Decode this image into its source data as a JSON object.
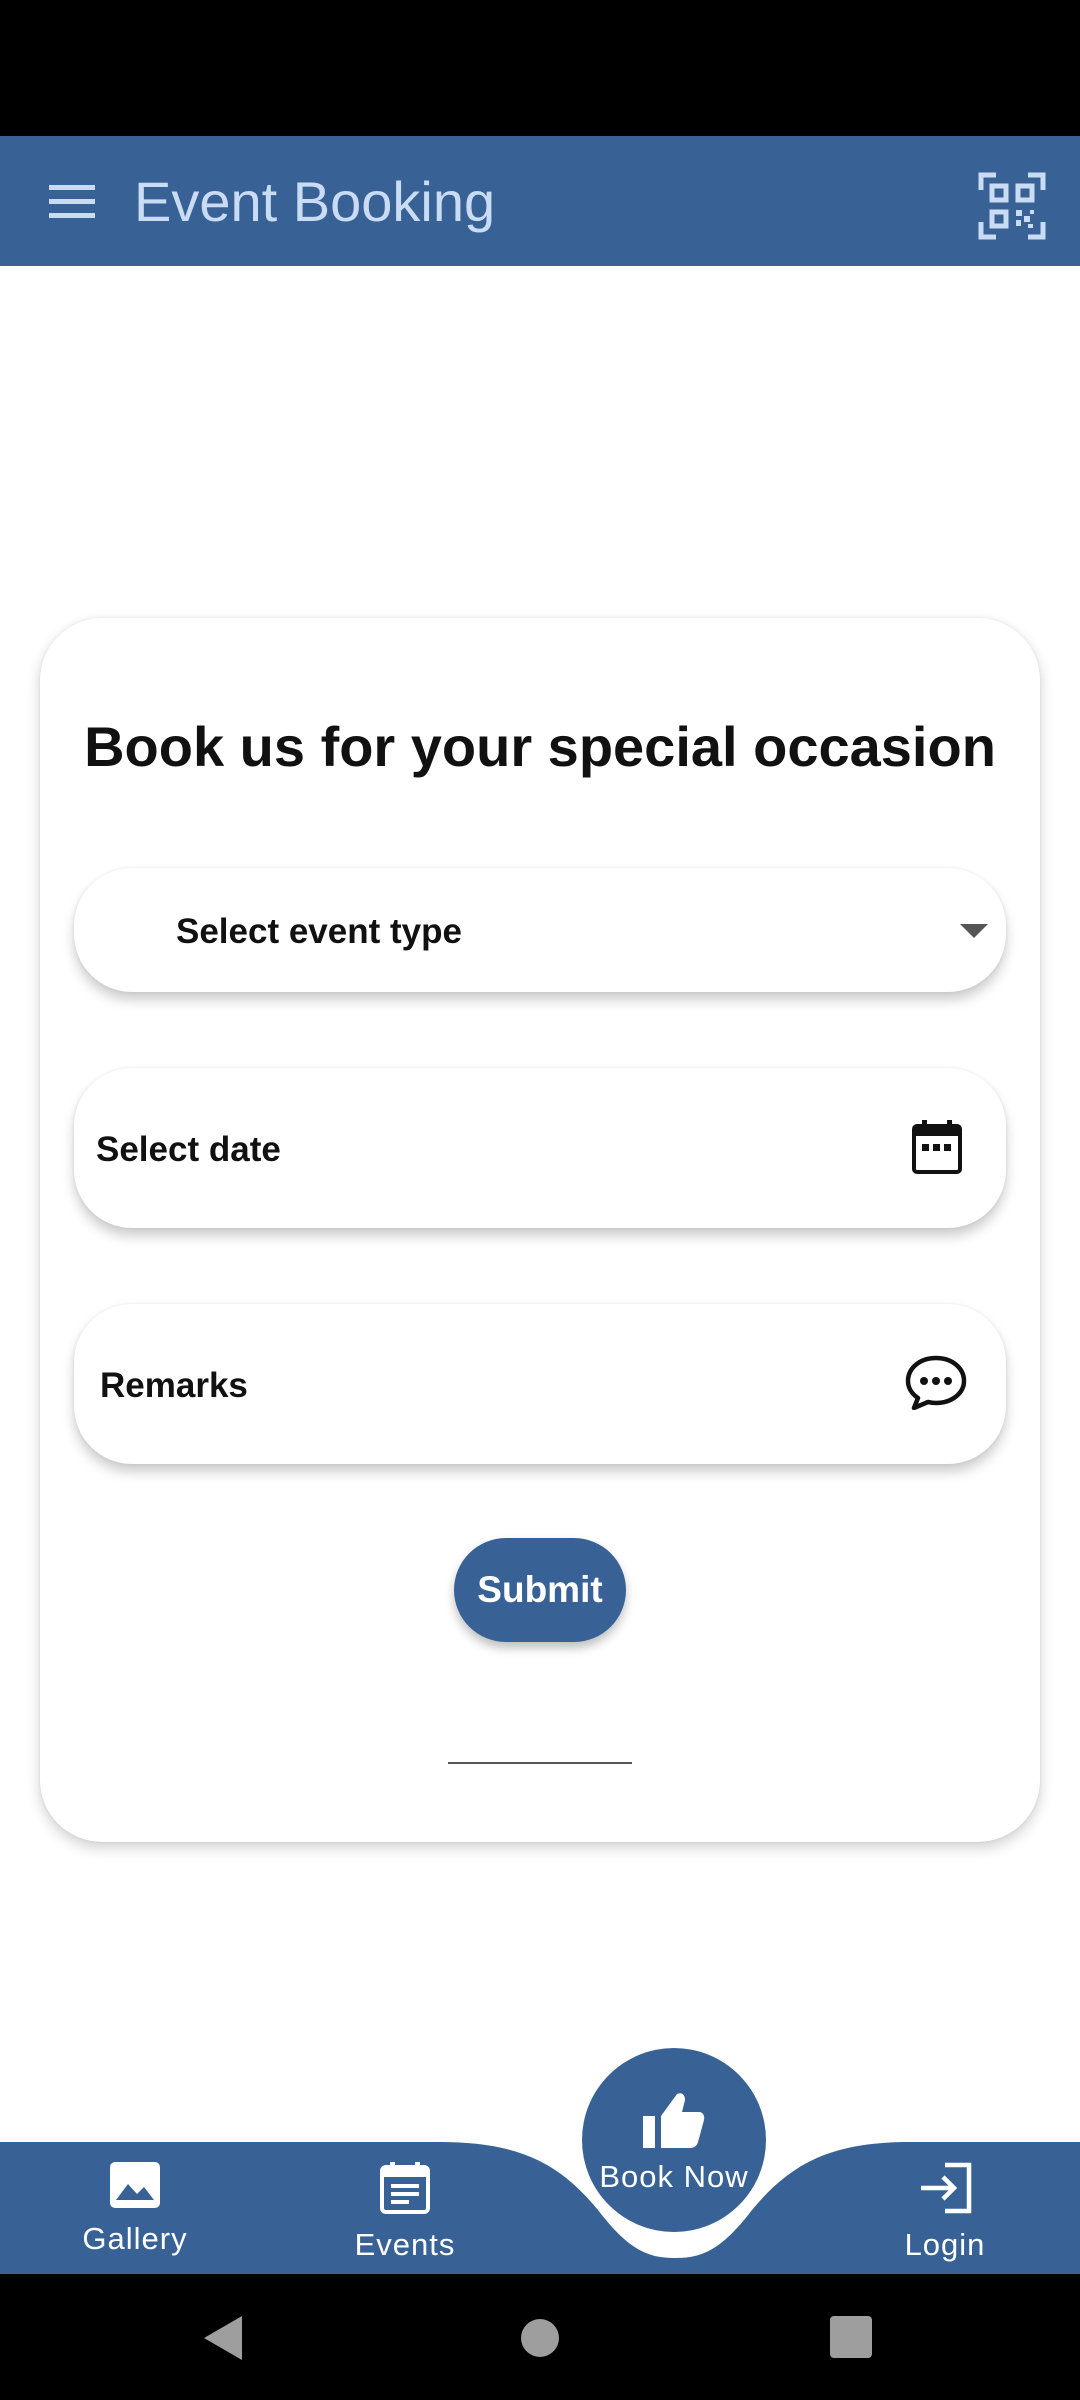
{
  "colors": {
    "primary": "#386296",
    "title_text": "#c9dcf4",
    "status_bar": "#000000"
  },
  "app_bar": {
    "title": "Event Booking",
    "menu_icon": "hamburger-menu-icon",
    "qr_icon": "qr-code-scan-icon"
  },
  "booking_card": {
    "heading": "Book us for your special occasion",
    "event_type": {
      "label": "Select event type",
      "icon": "dropdown-arrow-icon"
    },
    "date": {
      "label": "Select date",
      "icon": "calendar-icon"
    },
    "remarks": {
      "label": "Remarks",
      "icon": "chat-bubble-icon"
    },
    "submit_label": "Submit"
  },
  "bottom_nav": {
    "items": [
      {
        "label": "Gallery",
        "icon": "image-icon"
      },
      {
        "label": "Events",
        "icon": "event-note-icon"
      },
      {
        "label": "Book Now",
        "icon": "thumbs-up-icon"
      },
      {
        "label": "Login",
        "icon": "login-icon"
      }
    ]
  },
  "system_nav": {
    "buttons": [
      "back-icon",
      "home-icon",
      "recents-icon"
    ]
  }
}
